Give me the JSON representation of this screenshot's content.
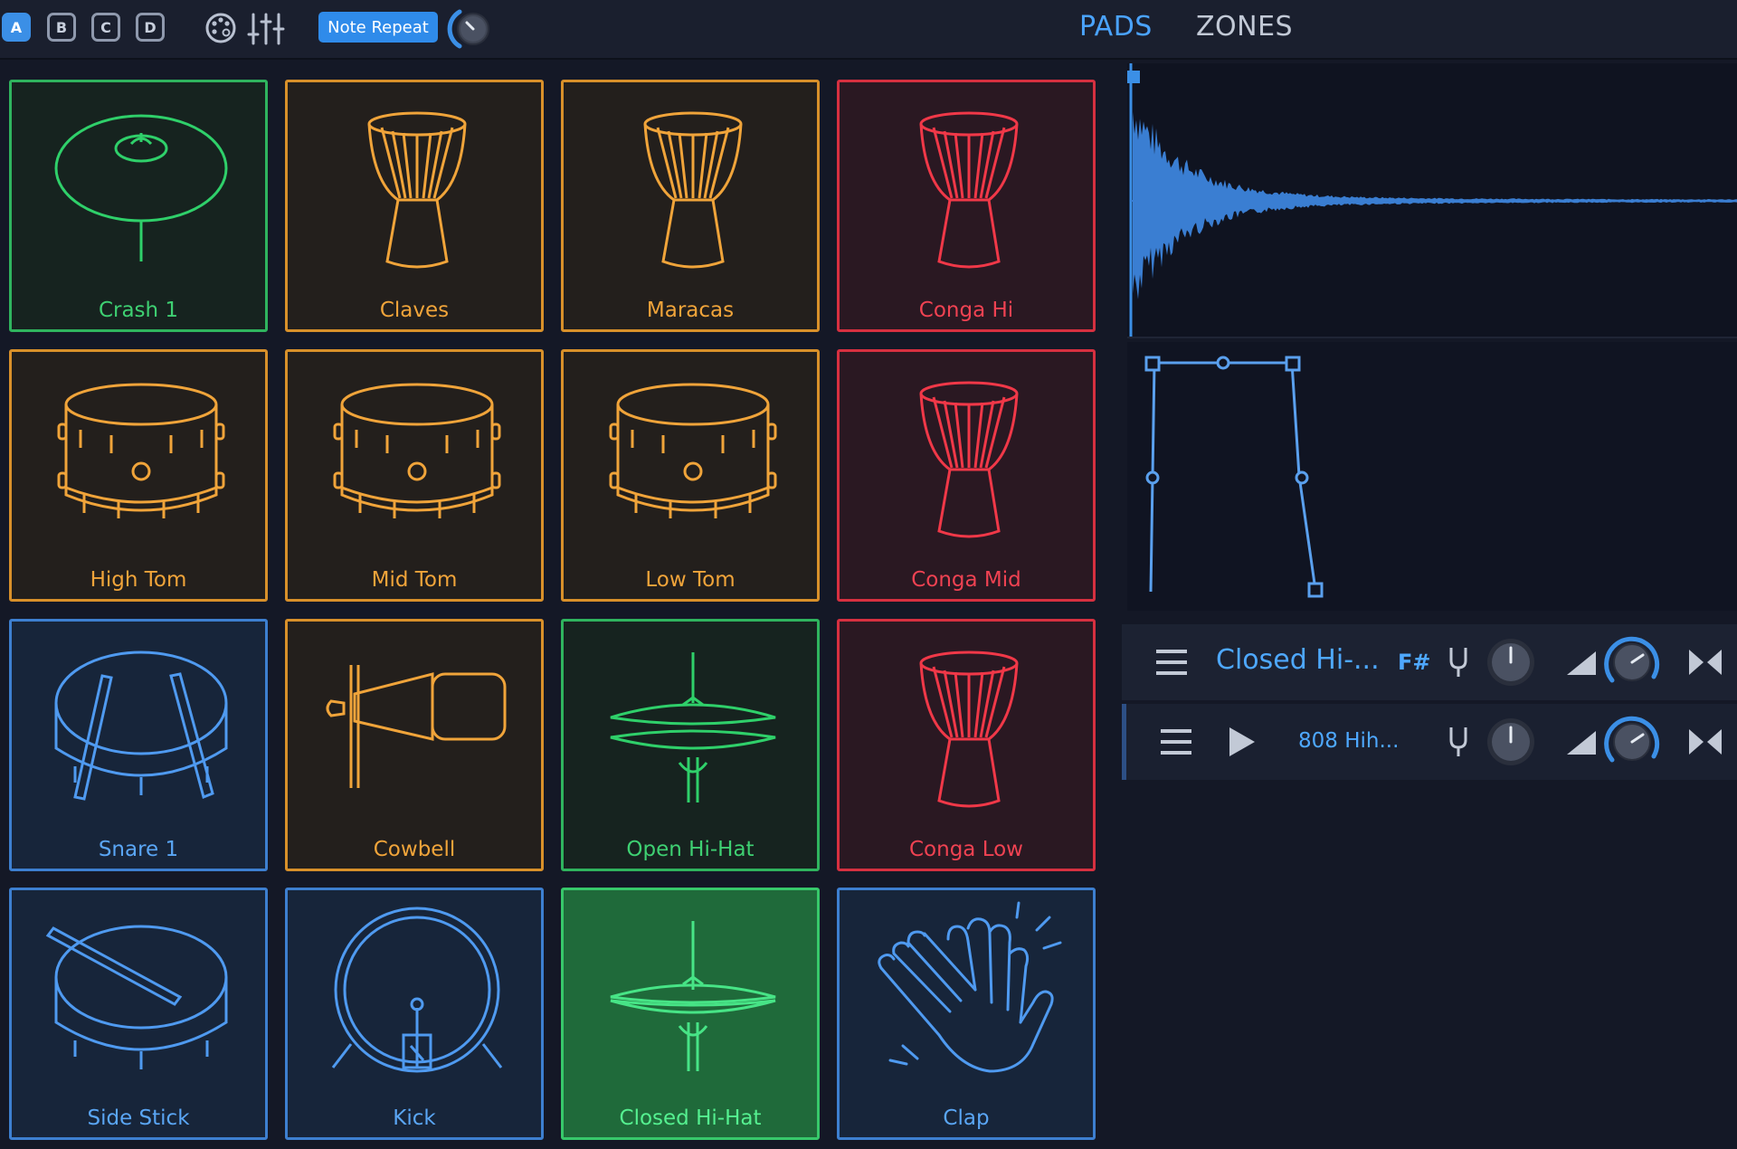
{
  "banks": [
    {
      "label": "A",
      "active": true
    },
    {
      "label": "B",
      "active": false
    },
    {
      "label": "C",
      "active": false
    },
    {
      "label": "D",
      "active": false
    }
  ],
  "toolbar": {
    "note_repeat_label": "Note Repeat",
    "palette_icon": "palette-icon",
    "mixer_icon": "mixer-sliders-icon"
  },
  "tabs": [
    {
      "label": "PADS",
      "active": true
    },
    {
      "label": "ZONES",
      "active": false
    }
  ],
  "pads": [
    {
      "label": "Crash 1",
      "color": "green",
      "icon": "crash-cymbal-icon"
    },
    {
      "label": "Claves",
      "color": "orange",
      "icon": "djembe-icon"
    },
    {
      "label": "Maracas",
      "color": "orange",
      "icon": "djembe-icon"
    },
    {
      "label": "Conga Hi",
      "color": "red",
      "icon": "conga-icon"
    },
    {
      "label": "High Tom",
      "color": "orange",
      "icon": "tom-drum-icon"
    },
    {
      "label": "Mid Tom",
      "color": "orange",
      "icon": "tom-drum-icon"
    },
    {
      "label": "Low Tom",
      "color": "orange",
      "icon": "tom-drum-icon"
    },
    {
      "label": "Conga Mid",
      "color": "red",
      "icon": "conga-icon"
    },
    {
      "label": "Snare 1",
      "color": "blue",
      "icon": "snare-drum-icon"
    },
    {
      "label": "Cowbell",
      "color": "orange",
      "icon": "cowbell-icon"
    },
    {
      "label": "Open Hi-Hat",
      "color": "green",
      "icon": "open-hihat-icon"
    },
    {
      "label": "Conga Low",
      "color": "red",
      "icon": "conga-icon"
    },
    {
      "label": "Side Stick",
      "color": "blue",
      "icon": "side-stick-icon"
    },
    {
      "label": "Kick",
      "color": "blue",
      "icon": "kick-drum-icon"
    },
    {
      "label": "Closed Hi-Hat",
      "color": "green",
      "icon": "closed-hihat-icon",
      "lit": true
    },
    {
      "label": "Clap",
      "color": "blue",
      "icon": "clap-hands-icon"
    }
  ],
  "layers": [
    {
      "name": "Closed Hi-...",
      "note": "F#",
      "has_play": false
    },
    {
      "name": "808 Hih...",
      "note": "",
      "has_play": true
    }
  ],
  "colors": {
    "accent": "#4aa3ff",
    "green": "#2fb45e",
    "orange": "#d8902a",
    "red": "#d63040",
    "blue": "#3d7fd0"
  }
}
